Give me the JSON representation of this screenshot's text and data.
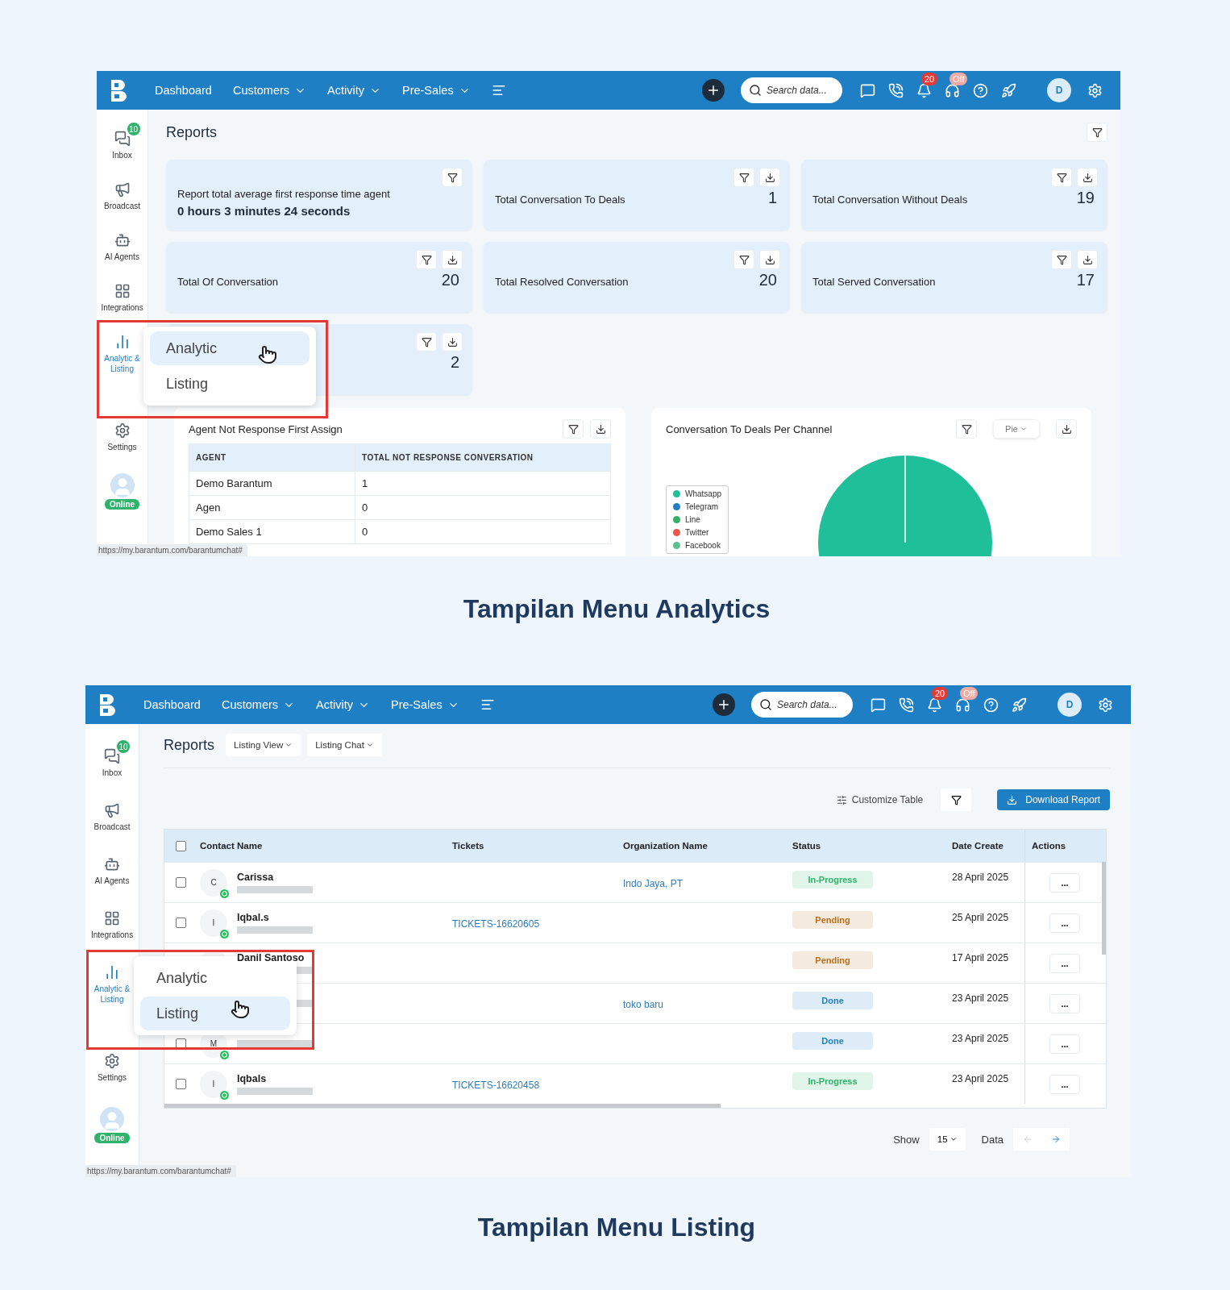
{
  "analytics_screen": {
    "kind": "analytics",
    "nav": {
      "menu": [
        {
          "label": "Dashboard",
          "dropdown": false
        },
        {
          "label": "Customers",
          "dropdown": true
        },
        {
          "label": "Activity",
          "dropdown": true
        },
        {
          "label": "Pre-Sales",
          "dropdown": true
        }
      ],
      "search_placeholder": "Search data...",
      "notification_count": "20",
      "status_badge": "Off",
      "avatar_initial": "D"
    },
    "sidebar": {
      "items": [
        {
          "kind": "inbox",
          "label": "Inbox",
          "badge": "10",
          "selected": false
        },
        {
          "kind": "broadcast",
          "label": "Broadcast",
          "selected": false
        },
        {
          "kind": "agents",
          "label": "AI Agents",
          "selected": false
        },
        {
          "kind": "integrations",
          "label": "Integrations",
          "selected": false
        },
        {
          "kind": "analytic",
          "label": "Analytic & Listing",
          "selected": true
        },
        {
          "kind": "settings",
          "label": "Settings",
          "selected": false
        }
      ],
      "presence": "Online"
    },
    "popup": [
      {
        "label": "Analytic",
        "selected": true
      },
      {
        "label": "Listing",
        "selected": false
      }
    ],
    "status_url": "https://my.barantum.com/barantumchat#",
    "title": "Reports",
    "cards": [
      {
        "kind": "text",
        "label": "Report total average first response time agent",
        "value": "0 hours 3 minutes 24 seconds",
        "download": false
      },
      {
        "kind": "number",
        "label": "Total Conversation To Deals",
        "value": "1",
        "download": true
      },
      {
        "kind": "number",
        "label": "Total Conversation Without Deals",
        "value": "19",
        "download": true
      },
      {
        "kind": "number",
        "label": "Total Of Conversation",
        "value": "20",
        "download": true
      },
      {
        "kind": "number",
        "label": "Total Resolved Conversation",
        "value": "20",
        "download": true
      },
      {
        "kind": "number",
        "label": "Total Served Conversation",
        "value": "17",
        "download": true
      },
      {
        "kind": "number",
        "value": "2",
        "download": true
      }
    ],
    "agent_table": {
      "title": "Agent Not Response First Assign",
      "columns": [
        "AGENT",
        "TOTAL NOT RESPONSE CONVERSATION"
      ],
      "rows": [
        [
          "Demo Barantum",
          "1"
        ],
        [
          "Agen",
          "0"
        ],
        [
          "Demo Sales 1",
          "0"
        ]
      ]
    },
    "pie_panel": {
      "title": "Conversation To Deals Per Channel",
      "chart_type": "Pie",
      "legend": [
        {
          "label": "Whatsapp",
          "color": "#1fbf9a"
        },
        {
          "label": "Telegram",
          "color": "#1e7fc4"
        },
        {
          "label": "Line",
          "color": "#2fb36b"
        },
        {
          "label": "Twitter",
          "color": "#e8574a"
        },
        {
          "label": "Facebook",
          "color": "#5cc08f"
        }
      ]
    }
  },
  "analytics_caption": "Tampilan Menu Analytics",
  "listing_screen": {
    "kind": "listing",
    "nav": {
      "menu": [
        {
          "label": "Dashboard",
          "dropdown": false
        },
        {
          "label": "Customers",
          "dropdown": true
        },
        {
          "label": "Activity",
          "dropdown": true
        },
        {
          "label": "Pre-Sales",
          "dropdown": true
        }
      ],
      "search_placeholder": "Search data...",
      "notification_count": "20",
      "status_badge": "Off",
      "avatar_initial": "D"
    },
    "sidebar": {
      "items": [
        {
          "kind": "inbox",
          "label": "Inbox",
          "badge": "10",
          "selected": false
        },
        {
          "kind": "broadcast",
          "label": "Broadcast",
          "selected": false
        },
        {
          "kind": "agents",
          "label": "AI Agents",
          "selected": false
        },
        {
          "kind": "integrations",
          "label": "Integrations",
          "selected": false
        },
        {
          "kind": "analytic",
          "label": "Analytic & Listing",
          "selected": true
        },
        {
          "kind": "settings",
          "label": "Settings",
          "selected": false
        }
      ],
      "presence": "Online"
    },
    "popup": [
      {
        "label": "Analytic",
        "selected": false
      },
      {
        "label": "Listing",
        "selected": true
      }
    ],
    "status_url": "https://my.barantum.com/barantumchat#",
    "title": "Reports",
    "views": [
      "Listing View",
      "Listing Chat"
    ],
    "customize": "Customize Table",
    "download": "Download Report",
    "columns": [
      "Contact Name",
      "Tickets",
      "Organization Name",
      "Status",
      "Date Create",
      "Actions"
    ],
    "header_checked": false,
    "rows": [
      {
        "checked": false,
        "initial": "C",
        "name": "Carissa",
        "org": "Indo Jaya, PT",
        "status": "In-Progress",
        "color": "#2fb36b",
        "date": "28 April 2025",
        "action": "..."
      },
      {
        "checked": false,
        "initial": "I",
        "name": "Iqbal.s",
        "ticket": "TICKETS-16620605",
        "status": "Pending",
        "color": "#b8701e",
        "date": "25 April 2025",
        "action": "..."
      },
      {
        "name": "Danil Santoso",
        "status": "Pending",
        "color": "#b8701e",
        "date": "17 April 2025",
        "action": "..."
      },
      {
        "org": "toko baru",
        "status": "Done",
        "color": "#1e7fc4",
        "date": "23 April 2025",
        "action": "..."
      },
      {
        "checked": false,
        "initial": "M",
        "status": "Done",
        "color": "#1e7fc4",
        "date": "23 April 2025",
        "action": "..."
      },
      {
        "checked": false,
        "initial": "I",
        "name": "Iqbals",
        "ticket": "TICKETS-16620458",
        "status": "In-Progress",
        "color": "#2fb36b",
        "date": "23 April 2025",
        "action": "..."
      }
    ],
    "pagination": {
      "show_label": "Show",
      "page_size": "15",
      "data_label": "Data"
    }
  },
  "listing_caption": "Tampilan Menu Listing"
}
